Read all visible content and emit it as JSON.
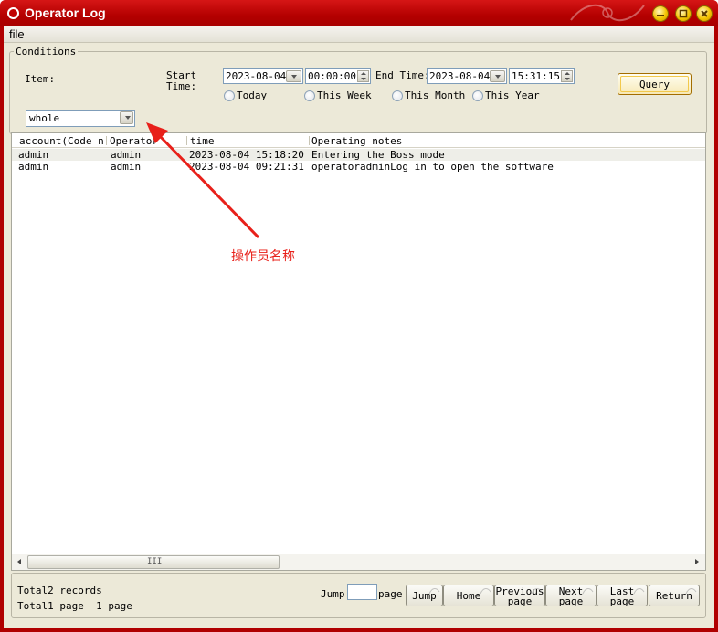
{
  "window": {
    "title": "Operator Log",
    "controls": [
      "minimize-icon",
      "maximize-icon",
      "close-icon"
    ]
  },
  "menu": {
    "file": "file"
  },
  "conditions": {
    "legend": "Conditions",
    "item_label": "Item:",
    "start_label_1": "Start",
    "start_label_2": "Time:",
    "start_date": "2023-08-04",
    "start_time": "00:00:00",
    "end_label": "End Time:",
    "end_date": "2023-08-04",
    "end_time": "15:31:15",
    "radios": [
      "Today",
      "This Week",
      "This Month",
      "This Year"
    ],
    "query_button": "Query",
    "item_select_value": "whole"
  },
  "table": {
    "columns": [
      "account(Code na",
      "Operator",
      "time",
      "Operating notes"
    ],
    "rows": [
      [
        "admin",
        "admin",
        "2023-08-04 15:18:20",
        "Entering the Boss mode"
      ],
      [
        "admin",
        "admin",
        "2023-08-04 09:21:31",
        "operatoradminLog in to open the software"
      ]
    ],
    "scroll_thumb_grip": "III"
  },
  "pager": {
    "total_records": "Total2 records",
    "total_pages": "Total1 page  1 page",
    "jump_label": "Jump",
    "page_label": "page",
    "buttons": {
      "jump": "Jump",
      "home": "Home",
      "previous": "Previous page",
      "next": "Next page",
      "last": "Last page",
      "return": "Return"
    }
  },
  "annotation": {
    "text": "操作员名称",
    "color": "#e8201a"
  },
  "colors": {
    "titlebar": "#c00000",
    "window_bg": "#ece9d8",
    "query_border": "#a36d00"
  }
}
